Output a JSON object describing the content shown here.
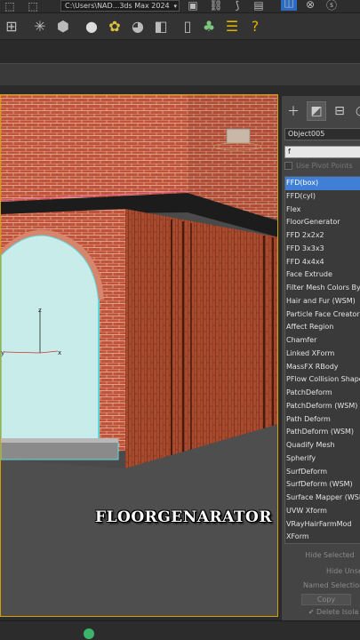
{
  "topbar": {
    "path": "C:\\Users\\NAD...3ds Max 2024"
  },
  "viewport": {
    "caption": "FLOORGENARATOR"
  },
  "panel": {
    "object_name": "Object005",
    "search_value": "f",
    "pivot_label": "Use Pivot Points",
    "modifiers": [
      "FFD(box)",
      "FFD(cyl)",
      "Flex",
      "FloorGenerator",
      "FFD 2x2x2",
      "FFD 3x3x3",
      "FFD 4x4x4",
      "Face Extrude",
      "Filter Mesh Colors By",
      "Hair and Fur (WSM)",
      "Particle Face Creator",
      "Affect Region",
      "Chamfer",
      "Linked XForm",
      "MassFX RBody",
      "PFlow Collision Shape",
      "PatchDeform",
      "PatchDeform (WSM)",
      "Path Deform",
      "PathDeform (WSM)",
      "Quadify Mesh",
      "Spherify",
      "SurfDeform",
      "SurfDeform (WSM)",
      "Surface Mapper (WSM)",
      "UVW Xform",
      "VRayHairFarmMod",
      "XForm"
    ],
    "selected_index": 0,
    "buttons": {
      "hide_selected": "Hide Selected",
      "hide_unselected": "Hide Unse",
      "named_selection": "Named Selection",
      "copy": "Copy",
      "delete_isolated": "Delete Isola"
    }
  }
}
